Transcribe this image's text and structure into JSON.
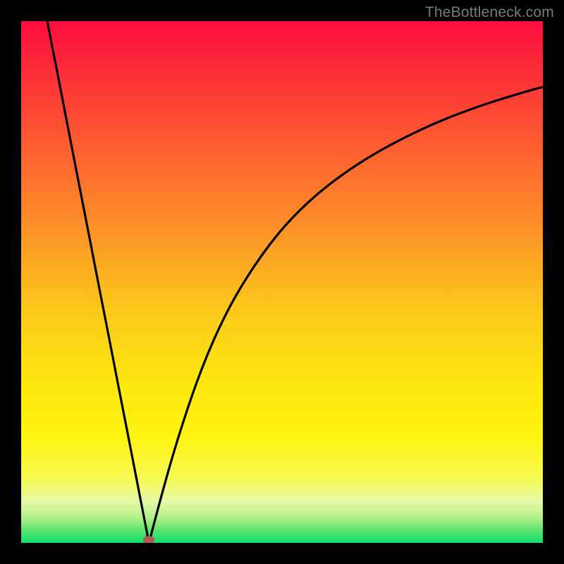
{
  "watermark": "TheBottleneck.com",
  "colors": {
    "top": "#fc0c3e",
    "upper_mid": "#fd8b29",
    "mid": "#fbc81b",
    "lower_mid": "#fef411",
    "pale": "#f2fa84",
    "near_bottom": "#7ee96d",
    "bottom": "#11de6f",
    "curve": "#000000",
    "marker": "#b15a4e",
    "frame": "#000000"
  },
  "chart_data": {
    "type": "line",
    "title": "",
    "xlabel": "",
    "ylabel": "",
    "xlim": [
      0,
      1
    ],
    "ylim": [
      0,
      1
    ],
    "minimum_x": 0.245,
    "minimum_y": 0.0,
    "marker": {
      "x": 0.245,
      "y": 0.006
    },
    "series": [
      {
        "name": "left-branch",
        "x": [
          0.05,
          0.07,
          0.09,
          0.11,
          0.13,
          0.15,
          0.17,
          0.19,
          0.21,
          0.23,
          0.245
        ],
        "y": [
          1.0,
          0.898,
          0.795,
          0.692,
          0.59,
          0.487,
          0.385,
          0.282,
          0.18,
          0.077,
          0.0
        ]
      },
      {
        "name": "right-branch",
        "x": [
          0.245,
          0.27,
          0.3,
          0.34,
          0.38,
          0.42,
          0.47,
          0.52,
          0.58,
          0.65,
          0.72,
          0.8,
          0.88,
          0.95,
          1.0
        ],
        "y": [
          0.0,
          0.095,
          0.2,
          0.32,
          0.415,
          0.49,
          0.565,
          0.625,
          0.68,
          0.73,
          0.77,
          0.808,
          0.838,
          0.86,
          0.874
        ]
      }
    ]
  }
}
